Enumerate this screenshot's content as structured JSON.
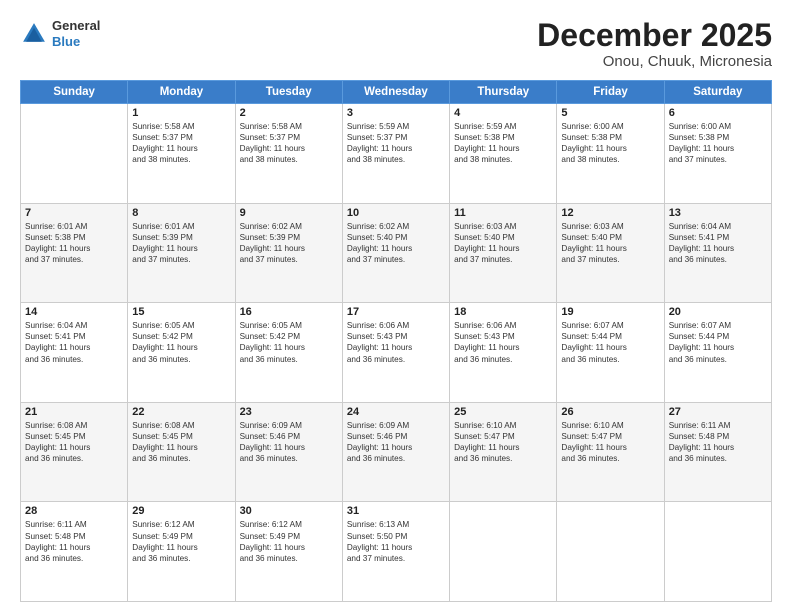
{
  "header": {
    "logo_general": "General",
    "logo_blue": "Blue",
    "title": "December 2025",
    "subtitle": "Onou, Chuuk, Micronesia"
  },
  "days_of_week": [
    "Sunday",
    "Monday",
    "Tuesday",
    "Wednesday",
    "Thursday",
    "Friday",
    "Saturday"
  ],
  "weeks": [
    [
      {
        "day": "",
        "info": ""
      },
      {
        "day": "1",
        "info": "Sunrise: 5:58 AM\nSunset: 5:37 PM\nDaylight: 11 hours\nand 38 minutes."
      },
      {
        "day": "2",
        "info": "Sunrise: 5:58 AM\nSunset: 5:37 PM\nDaylight: 11 hours\nand 38 minutes."
      },
      {
        "day": "3",
        "info": "Sunrise: 5:59 AM\nSunset: 5:37 PM\nDaylight: 11 hours\nand 38 minutes."
      },
      {
        "day": "4",
        "info": "Sunrise: 5:59 AM\nSunset: 5:38 PM\nDaylight: 11 hours\nand 38 minutes."
      },
      {
        "day": "5",
        "info": "Sunrise: 6:00 AM\nSunset: 5:38 PM\nDaylight: 11 hours\nand 38 minutes."
      },
      {
        "day": "6",
        "info": "Sunrise: 6:00 AM\nSunset: 5:38 PM\nDaylight: 11 hours\nand 37 minutes."
      }
    ],
    [
      {
        "day": "7",
        "info": "Sunrise: 6:01 AM\nSunset: 5:38 PM\nDaylight: 11 hours\nand 37 minutes."
      },
      {
        "day": "8",
        "info": "Sunrise: 6:01 AM\nSunset: 5:39 PM\nDaylight: 11 hours\nand 37 minutes."
      },
      {
        "day": "9",
        "info": "Sunrise: 6:02 AM\nSunset: 5:39 PM\nDaylight: 11 hours\nand 37 minutes."
      },
      {
        "day": "10",
        "info": "Sunrise: 6:02 AM\nSunset: 5:40 PM\nDaylight: 11 hours\nand 37 minutes."
      },
      {
        "day": "11",
        "info": "Sunrise: 6:03 AM\nSunset: 5:40 PM\nDaylight: 11 hours\nand 37 minutes."
      },
      {
        "day": "12",
        "info": "Sunrise: 6:03 AM\nSunset: 5:40 PM\nDaylight: 11 hours\nand 37 minutes."
      },
      {
        "day": "13",
        "info": "Sunrise: 6:04 AM\nSunset: 5:41 PM\nDaylight: 11 hours\nand 36 minutes."
      }
    ],
    [
      {
        "day": "14",
        "info": "Sunrise: 6:04 AM\nSunset: 5:41 PM\nDaylight: 11 hours\nand 36 minutes."
      },
      {
        "day": "15",
        "info": "Sunrise: 6:05 AM\nSunset: 5:42 PM\nDaylight: 11 hours\nand 36 minutes."
      },
      {
        "day": "16",
        "info": "Sunrise: 6:05 AM\nSunset: 5:42 PM\nDaylight: 11 hours\nand 36 minutes."
      },
      {
        "day": "17",
        "info": "Sunrise: 6:06 AM\nSunset: 5:43 PM\nDaylight: 11 hours\nand 36 minutes."
      },
      {
        "day": "18",
        "info": "Sunrise: 6:06 AM\nSunset: 5:43 PM\nDaylight: 11 hours\nand 36 minutes."
      },
      {
        "day": "19",
        "info": "Sunrise: 6:07 AM\nSunset: 5:44 PM\nDaylight: 11 hours\nand 36 minutes."
      },
      {
        "day": "20",
        "info": "Sunrise: 6:07 AM\nSunset: 5:44 PM\nDaylight: 11 hours\nand 36 minutes."
      }
    ],
    [
      {
        "day": "21",
        "info": "Sunrise: 6:08 AM\nSunset: 5:45 PM\nDaylight: 11 hours\nand 36 minutes."
      },
      {
        "day": "22",
        "info": "Sunrise: 6:08 AM\nSunset: 5:45 PM\nDaylight: 11 hours\nand 36 minutes."
      },
      {
        "day": "23",
        "info": "Sunrise: 6:09 AM\nSunset: 5:46 PM\nDaylight: 11 hours\nand 36 minutes."
      },
      {
        "day": "24",
        "info": "Sunrise: 6:09 AM\nSunset: 5:46 PM\nDaylight: 11 hours\nand 36 minutes."
      },
      {
        "day": "25",
        "info": "Sunrise: 6:10 AM\nSunset: 5:47 PM\nDaylight: 11 hours\nand 36 minutes."
      },
      {
        "day": "26",
        "info": "Sunrise: 6:10 AM\nSunset: 5:47 PM\nDaylight: 11 hours\nand 36 minutes."
      },
      {
        "day": "27",
        "info": "Sunrise: 6:11 AM\nSunset: 5:48 PM\nDaylight: 11 hours\nand 36 minutes."
      }
    ],
    [
      {
        "day": "28",
        "info": "Sunrise: 6:11 AM\nSunset: 5:48 PM\nDaylight: 11 hours\nand 36 minutes."
      },
      {
        "day": "29",
        "info": "Sunrise: 6:12 AM\nSunset: 5:49 PM\nDaylight: 11 hours\nand 36 minutes."
      },
      {
        "day": "30",
        "info": "Sunrise: 6:12 AM\nSunset: 5:49 PM\nDaylight: 11 hours\nand 36 minutes."
      },
      {
        "day": "31",
        "info": "Sunrise: 6:13 AM\nSunset: 5:50 PM\nDaylight: 11 hours\nand 37 minutes."
      },
      {
        "day": "",
        "info": ""
      },
      {
        "day": "",
        "info": ""
      },
      {
        "day": "",
        "info": ""
      }
    ]
  ]
}
